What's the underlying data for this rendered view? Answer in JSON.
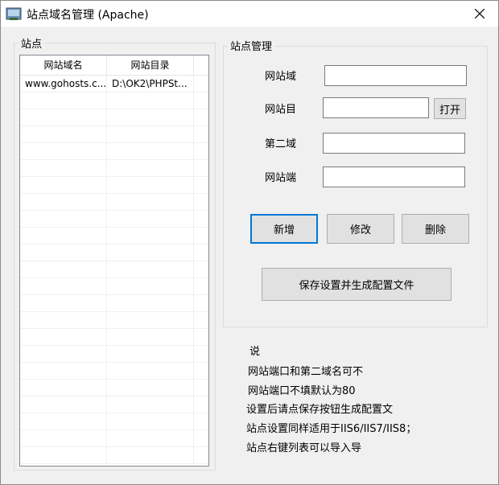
{
  "window": {
    "title": "站点域名管理 (Apache)"
  },
  "site_list": {
    "group_label": "站点",
    "columns": [
      "网站域名",
      "网站目录"
    ],
    "rows": [
      {
        "domain": "www.gohosts.c...",
        "dir": "D:\\OK2\\PHPSt..."
      }
    ]
  },
  "site_manage": {
    "group_label": "站点管理",
    "fields": {
      "domain_label": "网站域",
      "domain_value": "",
      "dir_label": "网站目",
      "dir_value": "",
      "second_domain_label": "第二域",
      "second_domain_value": "",
      "port_label": "网站端",
      "port_value": ""
    },
    "open_label": "打开",
    "add_label": "新增",
    "modify_label": "修改",
    "delete_label": "删除",
    "save_label": "保存设置并生成配置文件"
  },
  "notes": [
    "说",
    "网站端口和第二域名可不",
    "网站端口不填默认为80",
    "设置后请点保存按钮生成配置文",
    "站点设置同样适用于IIS6/IIS7/IIS8；",
    "站点右键列表可以导入导"
  ]
}
